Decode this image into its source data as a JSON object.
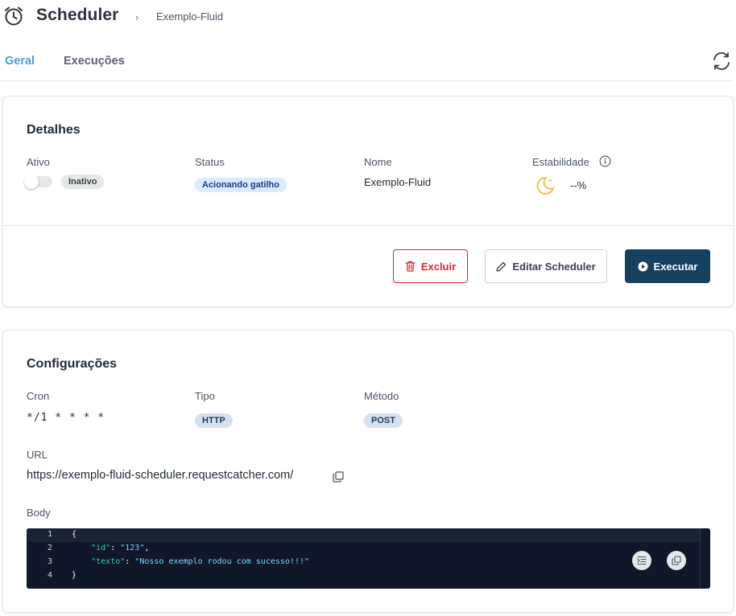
{
  "header": {
    "title": "Scheduler",
    "breadcrumb": "Exemplo-Fluid",
    "icon": "alarm-clock-icon"
  },
  "tabs": [
    {
      "label": "Geral",
      "active": true
    },
    {
      "label": "Execuções",
      "active": false
    }
  ],
  "details": {
    "title": "Detalhes",
    "ativo": {
      "label": "Ativo",
      "toggle_on": false,
      "badge": "Inativo"
    },
    "status": {
      "label": "Status",
      "badge": "Acionando gatilho"
    },
    "nome": {
      "label": "Nome",
      "value": "Exemplo-Fluid"
    },
    "estabilidade": {
      "label": "Estabilidade",
      "value": "--%",
      "icon": "moon-stars-icon"
    },
    "actions": {
      "delete": "Excluir",
      "edit": "Editar Scheduler",
      "run": "Executar"
    }
  },
  "config": {
    "title": "Configurações",
    "cron": {
      "label": "Cron",
      "value": "*/1 * * * *"
    },
    "tipo": {
      "label": "Tipo",
      "badge": "HTTP"
    },
    "metodo": {
      "label": "Método",
      "badge": "POST"
    },
    "url": {
      "label": "URL",
      "value": "https://exemplo-fluid-scheduler.requestcatcher.com/"
    },
    "body": {
      "label": "Body",
      "lines": [
        {
          "num": "1",
          "text": "{"
        },
        {
          "num": "2",
          "key": "\"id\"",
          "value": "\"123\"",
          "suffix": ","
        },
        {
          "num": "3",
          "key": "\"texto\"",
          "value": "\"Nosso exemplo rodou com sucesso!!!\"",
          "suffix": ""
        },
        {
          "num": "4",
          "text": "}"
        }
      ]
    }
  },
  "colors": {
    "accent": "#4f9bd9",
    "primary_button": "#16405f",
    "danger": "#dc2626",
    "code_bg": "#0f1729"
  }
}
